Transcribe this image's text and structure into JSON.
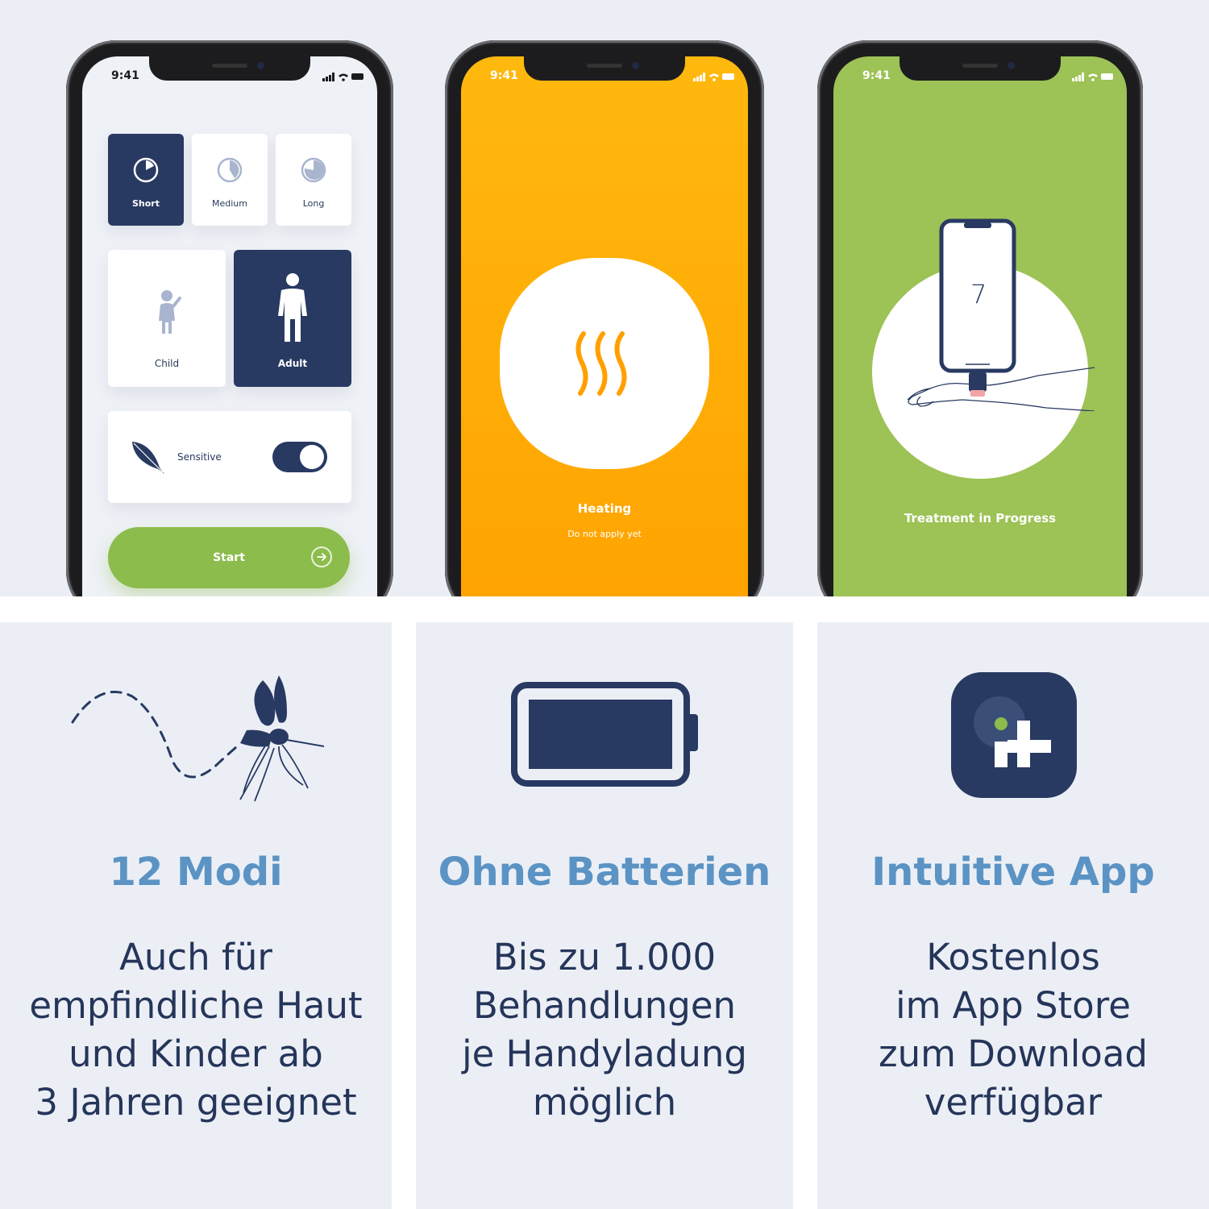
{
  "colors": {
    "navy": "#283a62",
    "green": "#8cbc4c",
    "orange": "#ffaa00",
    "title_blue": "#5b93c4",
    "panel_bg": "#ebeff5"
  },
  "phones": {
    "status_time": "9:41",
    "phone1": {
      "duration_options": [
        {
          "label": "Short",
          "icon": "timer-short-icon",
          "selected": true
        },
        {
          "label": "Medium",
          "icon": "timer-medium-icon",
          "selected": false
        },
        {
          "label": "Long",
          "icon": "timer-long-icon",
          "selected": false
        }
      ],
      "age_options": [
        {
          "label": "Child",
          "icon": "child-icon",
          "selected": false
        },
        {
          "label": "Adult",
          "icon": "adult-icon",
          "selected": true
        }
      ],
      "sensitive": {
        "label": "Sensitive",
        "icon": "feather-icon",
        "on": true
      },
      "start_label": "Start"
    },
    "phone2": {
      "status_label": "Heating",
      "hint": "Do not apply yet",
      "icon": "heat-waves-icon"
    },
    "phone3": {
      "status_label": "Treatment in Progress",
      "countdown": "7",
      "icon": "phone-on-arm-illustration"
    }
  },
  "features": [
    {
      "icon": "mosquito-icon",
      "title": "12 Modi",
      "lines": [
        "Auch für",
        "empfindliche Haut",
        "und Kinder ab",
        "3 Jahren geeignet"
      ]
    },
    {
      "icon": "battery-icon",
      "title": "Ohne Batterien",
      "lines": [
        "Bis zu 1.000",
        "Behandlungen",
        "je Handyladung",
        "möglich"
      ]
    },
    {
      "icon": "app-logo-icon",
      "title": "Intuitive App",
      "lines": [
        "Kostenlos",
        "im App Store",
        "zum Download",
        "verfügbar"
      ]
    }
  ]
}
